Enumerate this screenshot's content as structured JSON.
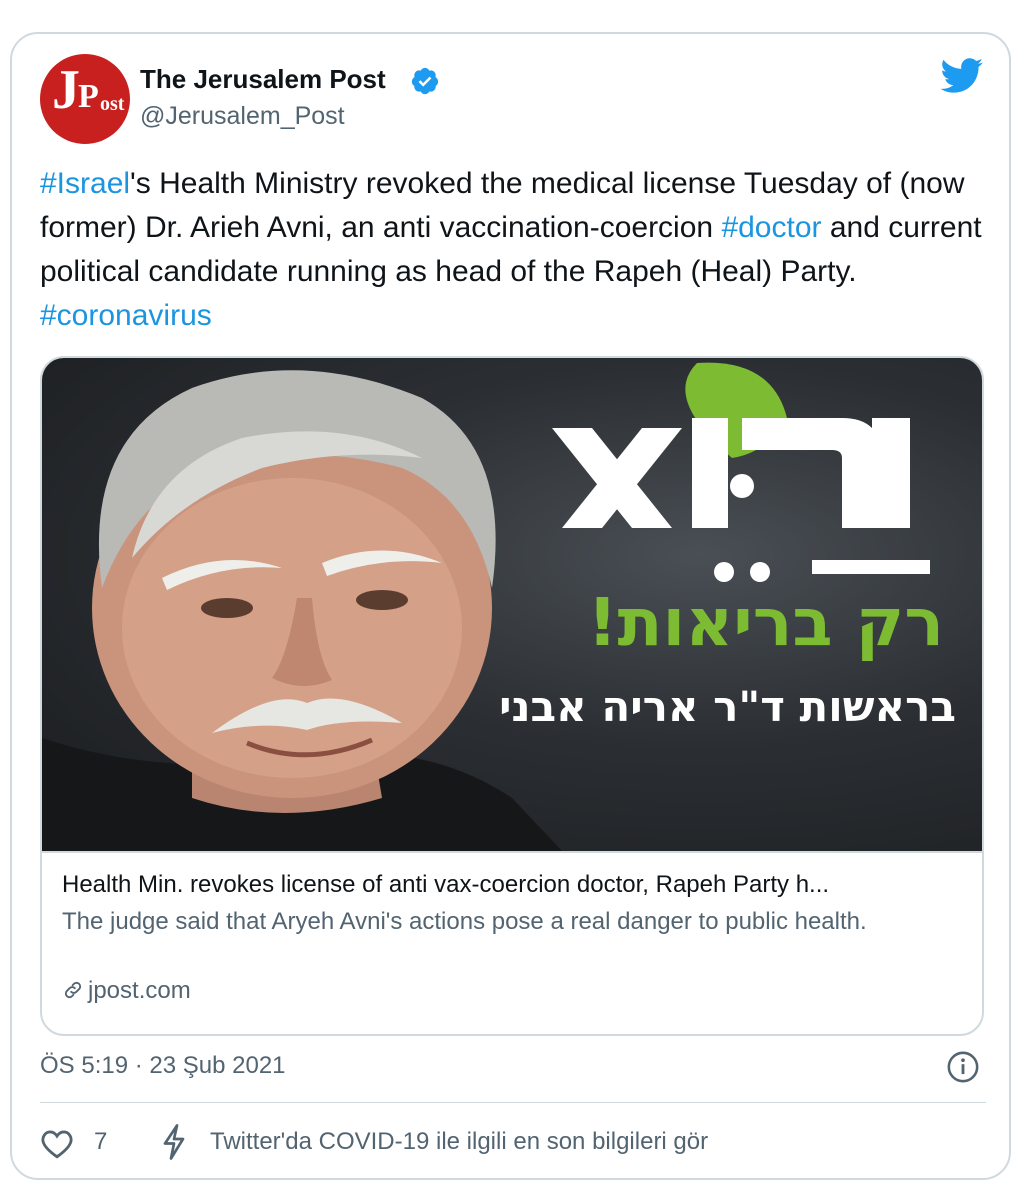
{
  "author": {
    "display_name": "The Jerusalem Post",
    "handle": "@Jerusalem_Post",
    "avatar_letters": {
      "j": "J",
      "p": "P",
      "ost": "ost"
    }
  },
  "tweet": {
    "segments": [
      {
        "text": "#Israel",
        "hashtag": true
      },
      {
        "text": "'s Health Ministry revoked the medical license Tuesday of (now former) Dr. Arieh Avni, an anti vaccination-coercion ",
        "hashtag": false
      },
      {
        "text": "#doctor",
        "hashtag": true
      },
      {
        "text": " and current political candidate running as head of the Rapeh (Heal) Party. ",
        "hashtag": false
      },
      {
        "text": "#coronavirus",
        "hashtag": true
      }
    ]
  },
  "card": {
    "image_text": {
      "logo": "רַפֵּא",
      "slogan": "רק בריאות!",
      "leader": "בראשות ד\"ר אריה אבני"
    },
    "title": "Health Min. revokes license of anti vax-coercion doctor, Rapeh Party h...",
    "description": "The judge said that Aryeh Avni's actions pose a real danger to public health.",
    "domain": "jpost.com"
  },
  "meta": {
    "timestamp": "ÖS 5:19 · 23 Şub 2021"
  },
  "actions": {
    "like_count": "7",
    "covid_link": "Twitter'da COVID-19 ile ilgili en son bilgileri gör"
  },
  "colors": {
    "hashtag": "#1b95e0",
    "verified": "#1d9bf0",
    "jpost_red": "#c8201e",
    "party_green": "#7cbb32"
  }
}
